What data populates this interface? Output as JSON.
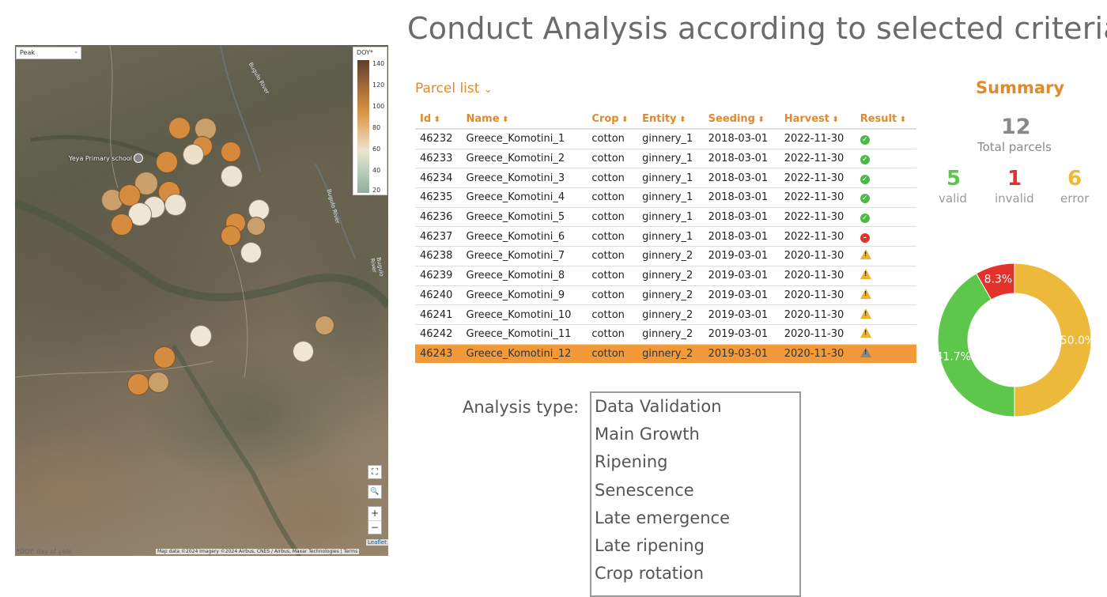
{
  "page_title": "Conduct Analysis according to selected criteria",
  "map": {
    "layer_select": "Peak",
    "legend_title": "DOY*",
    "legend_ticks": [
      "140",
      "120",
      "100",
      "80",
      "60",
      "40",
      "20"
    ],
    "place_label": "Yeya Primary school",
    "river_labels": [
      "Bugulo River",
      "Bugulo River",
      "Bugulo River"
    ],
    "zoom_in": "+",
    "zoom_out": "−",
    "leaflet": "Leaflet",
    "attribution": "Map data ©2024 Imagery ©2024 Airbus, CNES / Airbus, Maxar Technologies | Terms",
    "footnote": "*DOY: day of year",
    "colors": {
      "dark": "#5a3f2c",
      "orange": "#d8954a",
      "light": "#ece4cf",
      "teal": "#8fae9c"
    }
  },
  "parcel_list": {
    "heading": "Parcel list",
    "columns": [
      "Id",
      "Name",
      "Crop",
      "Entity",
      "Seeding",
      "Harvest",
      "Result"
    ],
    "rows": [
      {
        "id": "46232",
        "name": "Greece_Komotini_1",
        "crop": "cotton",
        "entity": "ginnery_1",
        "seeding": "2018-03-01",
        "harvest": "2022-11-30",
        "result": "valid"
      },
      {
        "id": "46233",
        "name": "Greece_Komotini_2",
        "crop": "cotton",
        "entity": "ginnery_1",
        "seeding": "2018-03-01",
        "harvest": "2022-11-30",
        "result": "valid"
      },
      {
        "id": "46234",
        "name": "Greece_Komotini_3",
        "crop": "cotton",
        "entity": "ginnery_1",
        "seeding": "2018-03-01",
        "harvest": "2022-11-30",
        "result": "valid"
      },
      {
        "id": "46235",
        "name": "Greece_Komotini_4",
        "crop": "cotton",
        "entity": "ginnery_1",
        "seeding": "2018-03-01",
        "harvest": "2022-11-30",
        "result": "valid"
      },
      {
        "id": "46236",
        "name": "Greece_Komotini_5",
        "crop": "cotton",
        "entity": "ginnery_1",
        "seeding": "2018-03-01",
        "harvest": "2022-11-30",
        "result": "valid"
      },
      {
        "id": "46237",
        "name": "Greece_Komotini_6",
        "crop": "cotton",
        "entity": "ginnery_1",
        "seeding": "2018-03-01",
        "harvest": "2022-11-30",
        "result": "invalid"
      },
      {
        "id": "46238",
        "name": "Greece_Komotini_7",
        "crop": "cotton",
        "entity": "ginnery_2",
        "seeding": "2019-03-01",
        "harvest": "2020-11-30",
        "result": "error"
      },
      {
        "id": "46239",
        "name": "Greece_Komotini_8",
        "crop": "cotton",
        "entity": "ginnery_2",
        "seeding": "2019-03-01",
        "harvest": "2020-11-30",
        "result": "error"
      },
      {
        "id": "46240",
        "name": "Greece_Komotini_9",
        "crop": "cotton",
        "entity": "ginnery_2",
        "seeding": "2019-03-01",
        "harvest": "2020-11-30",
        "result": "error"
      },
      {
        "id": "46241",
        "name": "Greece_Komotini_10",
        "crop": "cotton",
        "entity": "ginnery_2",
        "seeding": "2019-03-01",
        "harvest": "2020-11-30",
        "result": "error"
      },
      {
        "id": "46242",
        "name": "Greece_Komotini_11",
        "crop": "cotton",
        "entity": "ginnery_2",
        "seeding": "2019-03-01",
        "harvest": "2020-11-30",
        "result": "error"
      },
      {
        "id": "46243",
        "name": "Greece_Komotini_12",
        "crop": "cotton",
        "entity": "ginnery_2",
        "seeding": "2019-03-01",
        "harvest": "2020-11-30",
        "result": "error",
        "selected": true
      }
    ]
  },
  "summary": {
    "title": "Summary",
    "total": "12",
    "total_label": "Total parcels",
    "valid": "5",
    "valid_label": "valid",
    "valid_color": "#5cc74a",
    "invalid": "1",
    "invalid_label": "invalid",
    "invalid_color": "#e3312c",
    "error": "6",
    "error_label": "error",
    "error_color": "#ecb93a",
    "donut": [
      {
        "label": "error",
        "value": 50.0,
        "text": "50.0%",
        "color": "#ecb93a"
      },
      {
        "label": "valid",
        "value": 41.7,
        "text": "41.7%",
        "color": "#5cc74a"
      },
      {
        "label": "invalid",
        "value": 8.3,
        "text": "8.3%",
        "color": "#e3312c"
      }
    ]
  },
  "analysis": {
    "label": "Analysis type:",
    "options": [
      "Data Validation",
      "Main Growth",
      "Ripening",
      "Senescence",
      "Late emergence",
      "Late ripening",
      "Crop rotation"
    ]
  }
}
